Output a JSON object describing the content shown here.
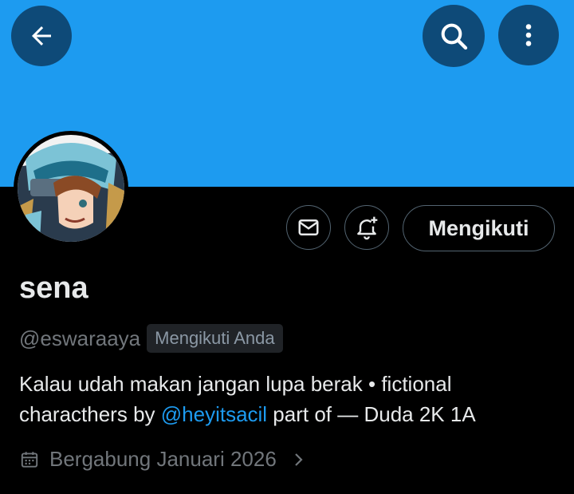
{
  "header": {
    "back_icon": "arrow-left-icon",
    "search_icon": "search-icon",
    "more_icon": "more-vertical-icon",
    "banner_color": "#1d9bf0",
    "button_color": "#0e4a78"
  },
  "profile": {
    "name": "sena",
    "handle": "@eswaraaya",
    "follows_you_badge": "Mengikuti Anda",
    "bio_text_1": "Kalau udah makan jangan lupa berak • fictional characthers by ",
    "bio_mention": "@heyitsacil",
    "bio_text_2": " part of — Duda 2K 1A",
    "joined": "Bergabung Januari 2026"
  },
  "actions": {
    "message_icon": "envelope-icon",
    "notify_icon": "bell-plus-icon",
    "follow_label": "Mengikuti"
  },
  "colors": {
    "accent": "#1d9bf0",
    "background": "#000000",
    "text": "#e7e9ea",
    "muted": "#71767b"
  }
}
